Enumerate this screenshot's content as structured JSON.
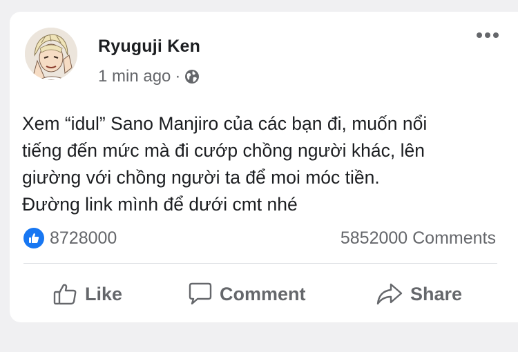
{
  "post": {
    "author": "Ryuguji Ken",
    "time": "1 min ago",
    "separator": "·",
    "privacy_icon": "globe-icon",
    "menu_icon": "more-options-icon",
    "text_lines": [
      "Xem “idul” Sano Manjiro của các bạn đi, muốn nổi",
      "tiếng đến mức mà đi cướp chồng người khác, lên",
      "giường với chồng người ta để moi móc tiền.",
      "Đường link mình để dưới cmt nhé"
    ]
  },
  "stats": {
    "like_count": "8728000",
    "comments": "5852000 Comments",
    "reaction_icon": "like-reaction-icon"
  },
  "actions": {
    "like_label": "Like",
    "comment_label": "Comment",
    "share_label": "Share"
  },
  "colors": {
    "accent": "#1877f2",
    "text": "#1c1e21",
    "muted": "#65676b",
    "background": "#f0f0f2"
  }
}
